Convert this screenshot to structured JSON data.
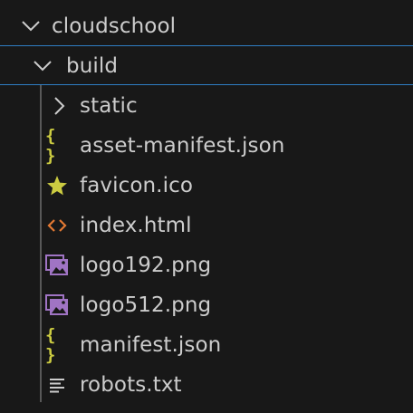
{
  "explorer": {
    "root": {
      "label": "cloudschool",
      "expanded": true
    },
    "build": {
      "label": "build",
      "expanded": true
    },
    "items": [
      {
        "label": "static",
        "type": "folder",
        "icon": "chevron-right-icon"
      },
      {
        "label": "asset-manifest.json",
        "type": "json",
        "icon": "json-icon",
        "glyph": "{ }",
        "color": "#cbcb41"
      },
      {
        "label": "favicon.ico",
        "type": "ico",
        "icon": "star-icon",
        "color": "#cbcb41"
      },
      {
        "label": "index.html",
        "type": "html",
        "icon": "html-code-icon",
        "color": "#e37933"
      },
      {
        "label": "logo192.png",
        "type": "png",
        "icon": "image-icon",
        "color": "#a074c4"
      },
      {
        "label": "logo512.png",
        "type": "png",
        "icon": "image-icon",
        "color": "#a074c4"
      },
      {
        "label": "manifest.json",
        "type": "json",
        "icon": "json-icon",
        "glyph": "{ }",
        "color": "#cbcb41"
      },
      {
        "label": "robots.txt",
        "type": "txt",
        "icon": "text-lines-icon",
        "color": "#cccccc"
      }
    ]
  },
  "colors": {
    "background": "#181818",
    "text": "#cccccc",
    "focus_border": "#2f7ec4",
    "indent_guide": "#585858"
  }
}
